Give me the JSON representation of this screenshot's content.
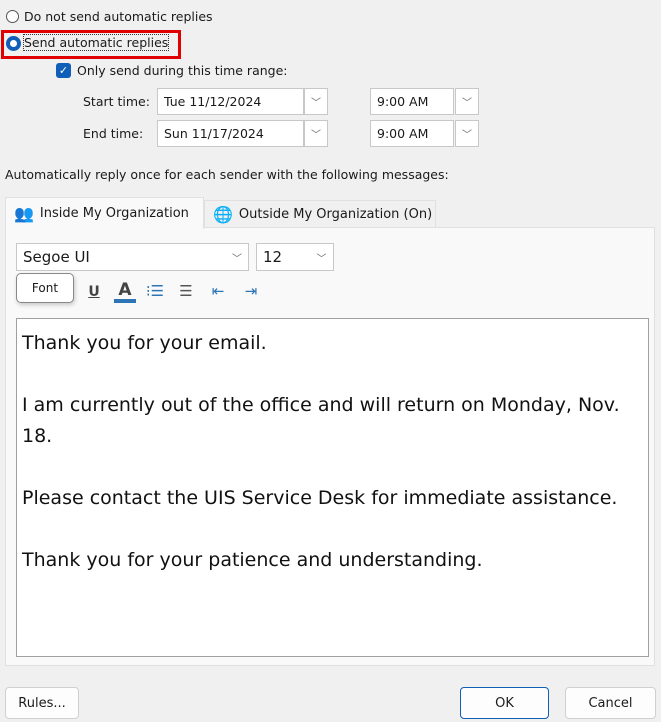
{
  "options": {
    "no_reply": "Do not send automatic replies",
    "send_reply": "Send automatic replies",
    "selected": "send_reply"
  },
  "time_range": {
    "label": "Only send during this time range:",
    "checked": true,
    "start_label": "Start time:",
    "start_date": "Tue 11/12/2024",
    "start_time": "9:00 AM",
    "end_label": "End time:",
    "end_date": "Sun 11/17/2024",
    "end_time": "9:00 AM"
  },
  "instructions": "Automatically reply once for each sender with the following messages:",
  "tabs": [
    {
      "label": "Inside My Organization",
      "active": true
    },
    {
      "label": "Outside My Organization (On)",
      "active": false
    }
  ],
  "editor": {
    "font": "Segoe UI",
    "size": "12",
    "tooltip": "Font",
    "underline": "U",
    "font_color": "A",
    "font_color_hex": "#2e75b6",
    "lines": [
      "Thank you for your email.",
      "I am currently out of the office and will return on Monday, Nov. 18.",
      "Please contact the UIS Service Desk for immediate assistance.",
      "Thank you for your patience and understanding."
    ]
  },
  "buttons": {
    "rules": "Rules...",
    "ok": "OK",
    "cancel": "Cancel"
  },
  "colors": {
    "accent": "#0f5fb8",
    "highlight": "#e00000"
  }
}
